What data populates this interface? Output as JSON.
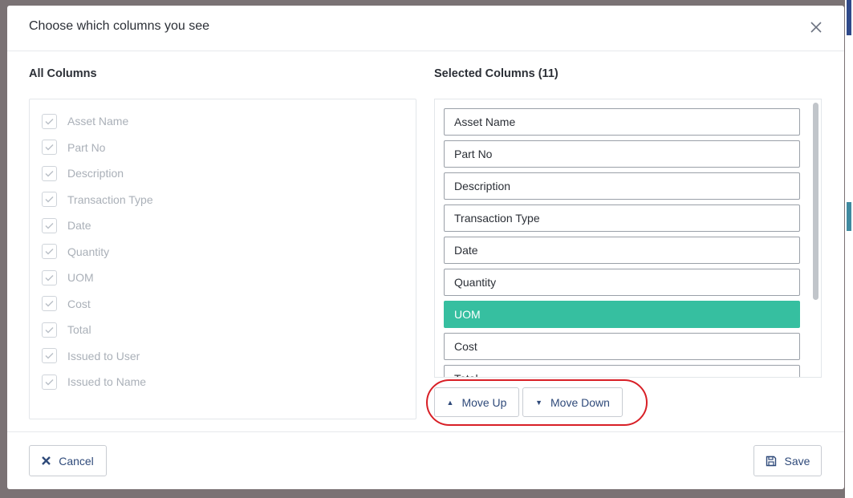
{
  "dialog": {
    "title": "Choose which columns you see",
    "close_icon": "close-icon"
  },
  "all_columns": {
    "title": "All Columns",
    "items": [
      {
        "label": "Asset Name",
        "checked": true
      },
      {
        "label": "Part No",
        "checked": true
      },
      {
        "label": "Description",
        "checked": true
      },
      {
        "label": "Transaction Type",
        "checked": true
      },
      {
        "label": "Date",
        "checked": true
      },
      {
        "label": "Quantity",
        "checked": true
      },
      {
        "label": "UOM",
        "checked": true
      },
      {
        "label": "Cost",
        "checked": true
      },
      {
        "label": "Total",
        "checked": true
      },
      {
        "label": "Issued to User",
        "checked": true
      },
      {
        "label": "Issued to Name",
        "checked": true
      }
    ]
  },
  "selected_columns": {
    "title": "Selected Columns (11)",
    "items": [
      "Asset Name",
      "Part No",
      "Description",
      "Transaction Type",
      "Date",
      "Quantity",
      "UOM",
      "Cost",
      "Total"
    ],
    "selected_item": "UOM"
  },
  "controls": {
    "move_up_label": "Move Up",
    "move_down_label": "Move Down",
    "cancel_label": "Cancel",
    "save_label": "Save"
  },
  "colors": {
    "accent": "#36bfa0",
    "button_text": "#2f4a7a",
    "highlight_ring": "#d81f26"
  }
}
